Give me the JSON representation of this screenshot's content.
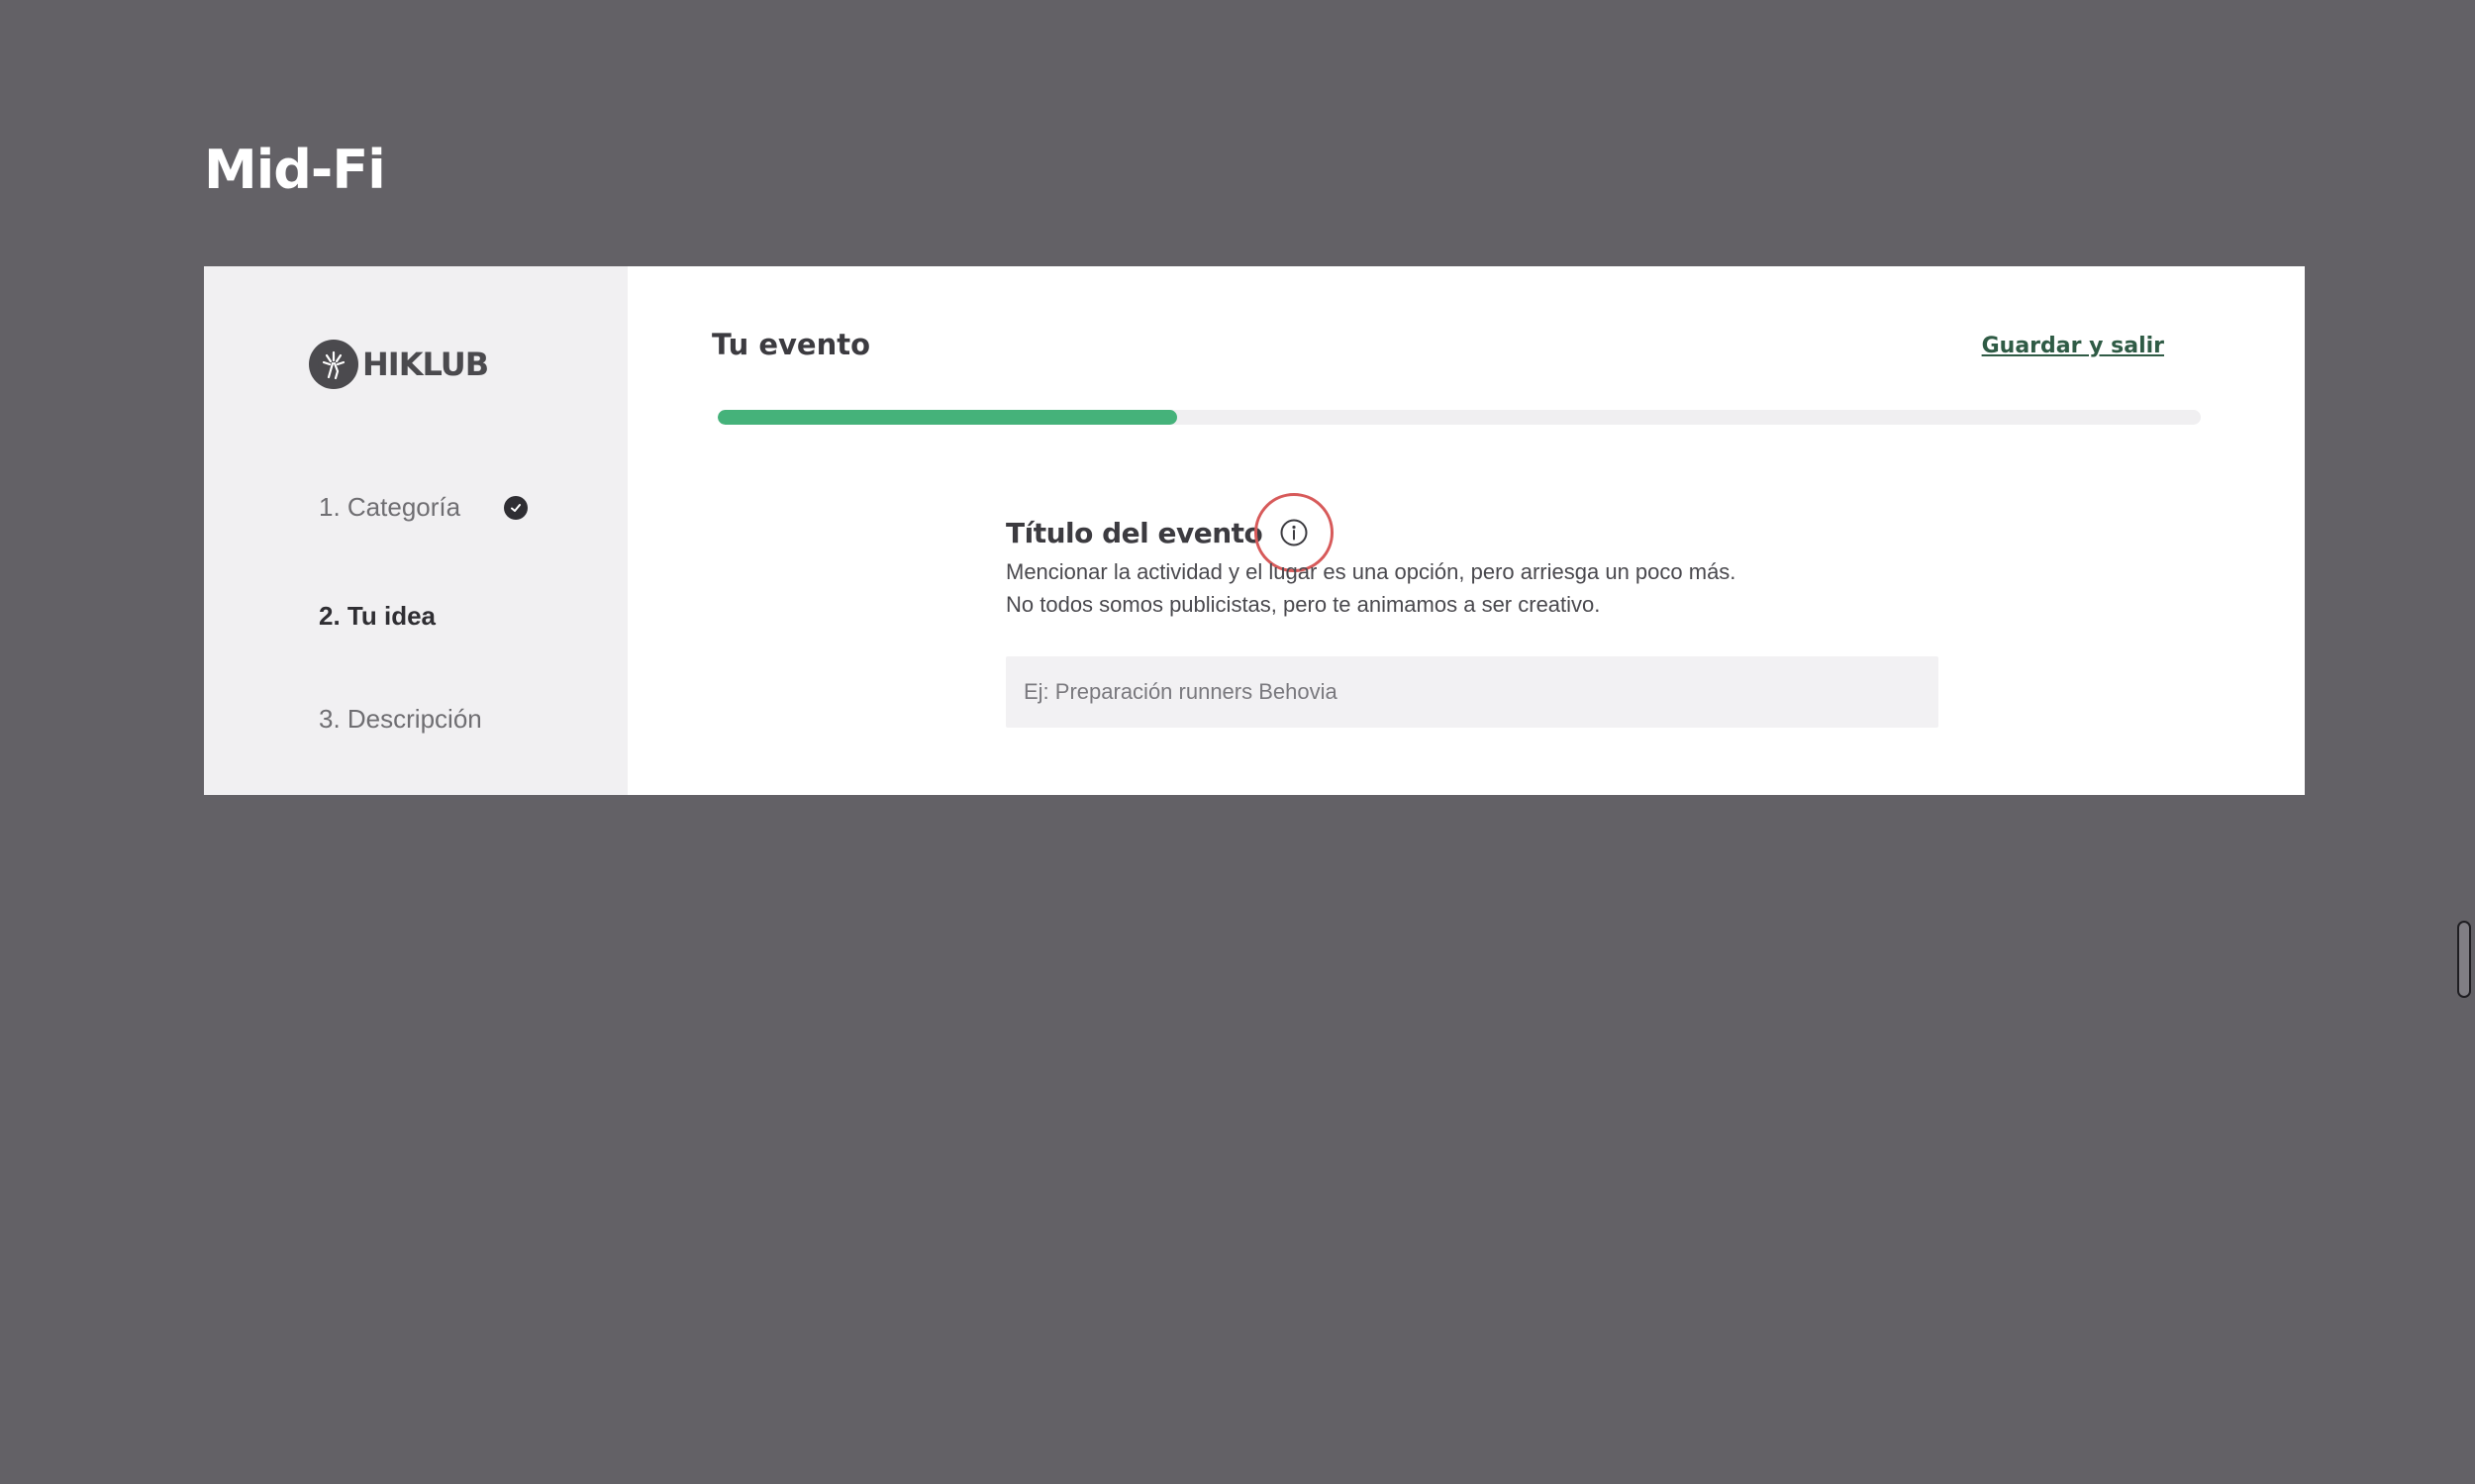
{
  "page": {
    "heading": "Mid-Fi"
  },
  "sidebar": {
    "logo_text": "HIKLUB",
    "steps": [
      {
        "label": "1. Categoría",
        "completed": true
      },
      {
        "label": "2. Tu idea",
        "active": true
      },
      {
        "label": "3. Descripción"
      }
    ]
  },
  "header": {
    "title": "Tu evento",
    "save_exit_label": "Guardar y salir",
    "progress_percent": 31
  },
  "form": {
    "field_title": "Título del evento",
    "help_line_1": "Mencionar la actividad y el lugar es una opción, pero arriesga un poco más.",
    "help_line_2": "No todos somos publicistas, pero te animamos a ser creativo.",
    "input_placeholder": "Ej: Preparación runners Behovia",
    "input_value": ""
  },
  "colors": {
    "background": "#636166",
    "accent_green": "#45b27a",
    "link_green": "#2f5b45",
    "highlight_red": "#d75a5a"
  },
  "icons": [
    "logo-mark-icon",
    "check-circle-icon",
    "info-icon"
  ]
}
